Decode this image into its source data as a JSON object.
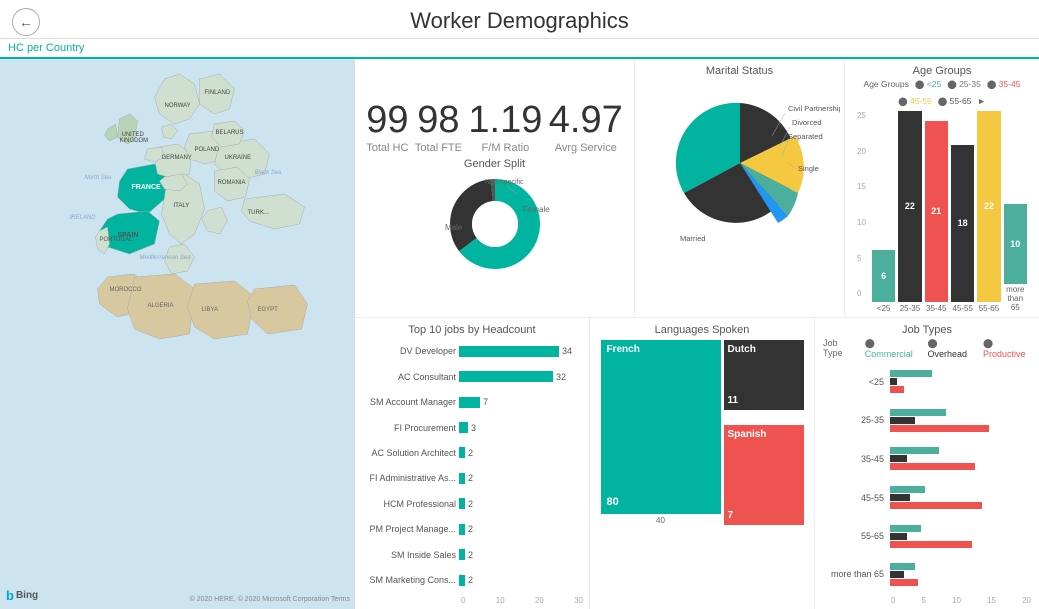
{
  "header": {
    "title": "Worker Demographics",
    "back_button": "←"
  },
  "section_label": "HC per Country",
  "stats": [
    {
      "value": "99",
      "label": "Total HC"
    },
    {
      "value": "98",
      "label": "Total FTE"
    },
    {
      "value": "1.19",
      "label": "F/M Ratio"
    },
    {
      "value": "4.97",
      "label": "Avrg Service"
    }
  ],
  "gender_split": {
    "title": "Gender Split",
    "labels": {
      "left": "Male",
      "right": "Female",
      "top": "Non-specific"
    }
  },
  "marital_status": {
    "title": "Marital Status",
    "labels": [
      "Civil Partnership",
      "Divorced",
      "Separated",
      "Single",
      "Married"
    ]
  },
  "age_groups": {
    "title": "Age Groups",
    "legend": [
      {
        "label": "<25",
        "color": "#4caf9e"
      },
      {
        "label": "25-35",
        "color": "#ef5350"
      },
      {
        "label": "35-45",
        "color": "#ef5350"
      },
      {
        "label": "45-55",
        "color": "#f5c842"
      },
      {
        "label": "55-65",
        "color": "#555"
      }
    ],
    "bars": [
      {
        "label": "<25",
        "value": 6,
        "color": "#4caf9e",
        "height_pct": 27
      },
      {
        "label": "25-35",
        "value": 22,
        "color": "#333",
        "height_pct": 100
      },
      {
        "label": "35-45",
        "value": 21,
        "color": "#ef5350",
        "height_pct": 95
      },
      {
        "label": "45-55",
        "value": 18,
        "color": "#333",
        "height_pct": 82
      },
      {
        "label": "55-65",
        "value": 22,
        "color": "#f5c842",
        "height_pct": 100
      },
      {
        "label": "more than 65",
        "value": 10,
        "color": "#4caf9e",
        "height_pct": 46
      }
    ],
    "x_labels": [
      "<25",
      "25-35",
      "35-45",
      "45-55",
      "55-65",
      "more\nthan 65"
    ]
  },
  "top10": {
    "title": "Top 10 jobs by Headcount",
    "items": [
      {
        "label": "DV Developer",
        "value": 34,
        "width_pct": 100
      },
      {
        "label": "AC Consultant",
        "value": 32,
        "width_pct": 94
      },
      {
        "label": "SM Account Manager",
        "value": 7,
        "width_pct": 21
      },
      {
        "label": "FI Procurement",
        "value": 3,
        "width_pct": 9
      },
      {
        "label": "AC Solution Architect",
        "value": 2,
        "width_pct": 6
      },
      {
        "label": "FI Administrative As...",
        "value": 2,
        "width_pct": 6
      },
      {
        "label": "HCM Professional",
        "value": 2,
        "width_pct": 6
      },
      {
        "label": "PM Project Manage...",
        "value": 2,
        "width_pct": 6
      },
      {
        "label": "SM Inside Sales",
        "value": 2,
        "width_pct": 6
      },
      {
        "label": "SM Marketing Cons...",
        "value": 2,
        "width_pct": 6
      }
    ],
    "axis_labels": [
      "0",
      "10",
      "20",
      "30"
    ]
  },
  "languages": {
    "title": "Languages Spoken",
    "blocks": [
      {
        "label": "French",
        "value": 80,
        "color": "#00b4a0",
        "width": 120,
        "height": 168
      },
      {
        "label": "Dutch",
        "value": 11,
        "color": "#333",
        "width": 75,
        "height": 60
      },
      {
        "label": "Spanish",
        "value": 7,
        "color": "#ef5350",
        "width": 75,
        "height": 100
      }
    ],
    "axis_label": "40"
  },
  "job_types": {
    "title": "Job Types",
    "legend": [
      {
        "label": "Commercial",
        "color": "#4caf9e"
      },
      {
        "label": "Overhead",
        "color": "#333"
      },
      {
        "label": "Productive",
        "color": "#ef5350"
      }
    ],
    "rows": [
      {
        "label": "<25",
        "bars": [
          {
            "color": "#4caf9e",
            "width_pct": 30
          },
          {
            "color": "#333",
            "width_pct": 5
          },
          {
            "color": "#ef5350",
            "width_pct": 10
          }
        ]
      },
      {
        "label": "25-35",
        "bars": [
          {
            "color": "#4caf9e",
            "width_pct": 40
          },
          {
            "color": "#333",
            "width_pct": 15
          },
          {
            "color": "#ef5350",
            "width_pct": 70
          }
        ]
      },
      {
        "label": "35-45",
        "bars": [
          {
            "color": "#4caf9e",
            "width_pct": 35
          },
          {
            "color": "#333",
            "width_pct": 10
          },
          {
            "color": "#ef5350",
            "width_pct": 60
          }
        ]
      },
      {
        "label": "45-55",
        "bars": [
          {
            "color": "#4caf9e",
            "width_pct": 25
          },
          {
            "color": "#333",
            "width_pct": 12
          },
          {
            "color": "#ef5350",
            "width_pct": 65
          }
        ]
      },
      {
        "label": "55-65",
        "bars": [
          {
            "color": "#4caf9e",
            "width_pct": 20
          },
          {
            "color": "#333",
            "width_pct": 10
          },
          {
            "color": "#ef5350",
            "width_pct": 60
          }
        ]
      },
      {
        "label": "more than 65",
        "bars": [
          {
            "color": "#4caf9e",
            "width_pct": 15
          },
          {
            "color": "#333",
            "width_pct": 8
          },
          {
            "color": "#ef5350",
            "width_pct": 20
          }
        ]
      }
    ],
    "axis_labels": [
      "0",
      "5",
      "10",
      "15",
      "20"
    ]
  },
  "map": {
    "bing_label": "Bing",
    "copyright": "© 2020 HERE, © 2020 Microsoft Corporation Terms"
  }
}
